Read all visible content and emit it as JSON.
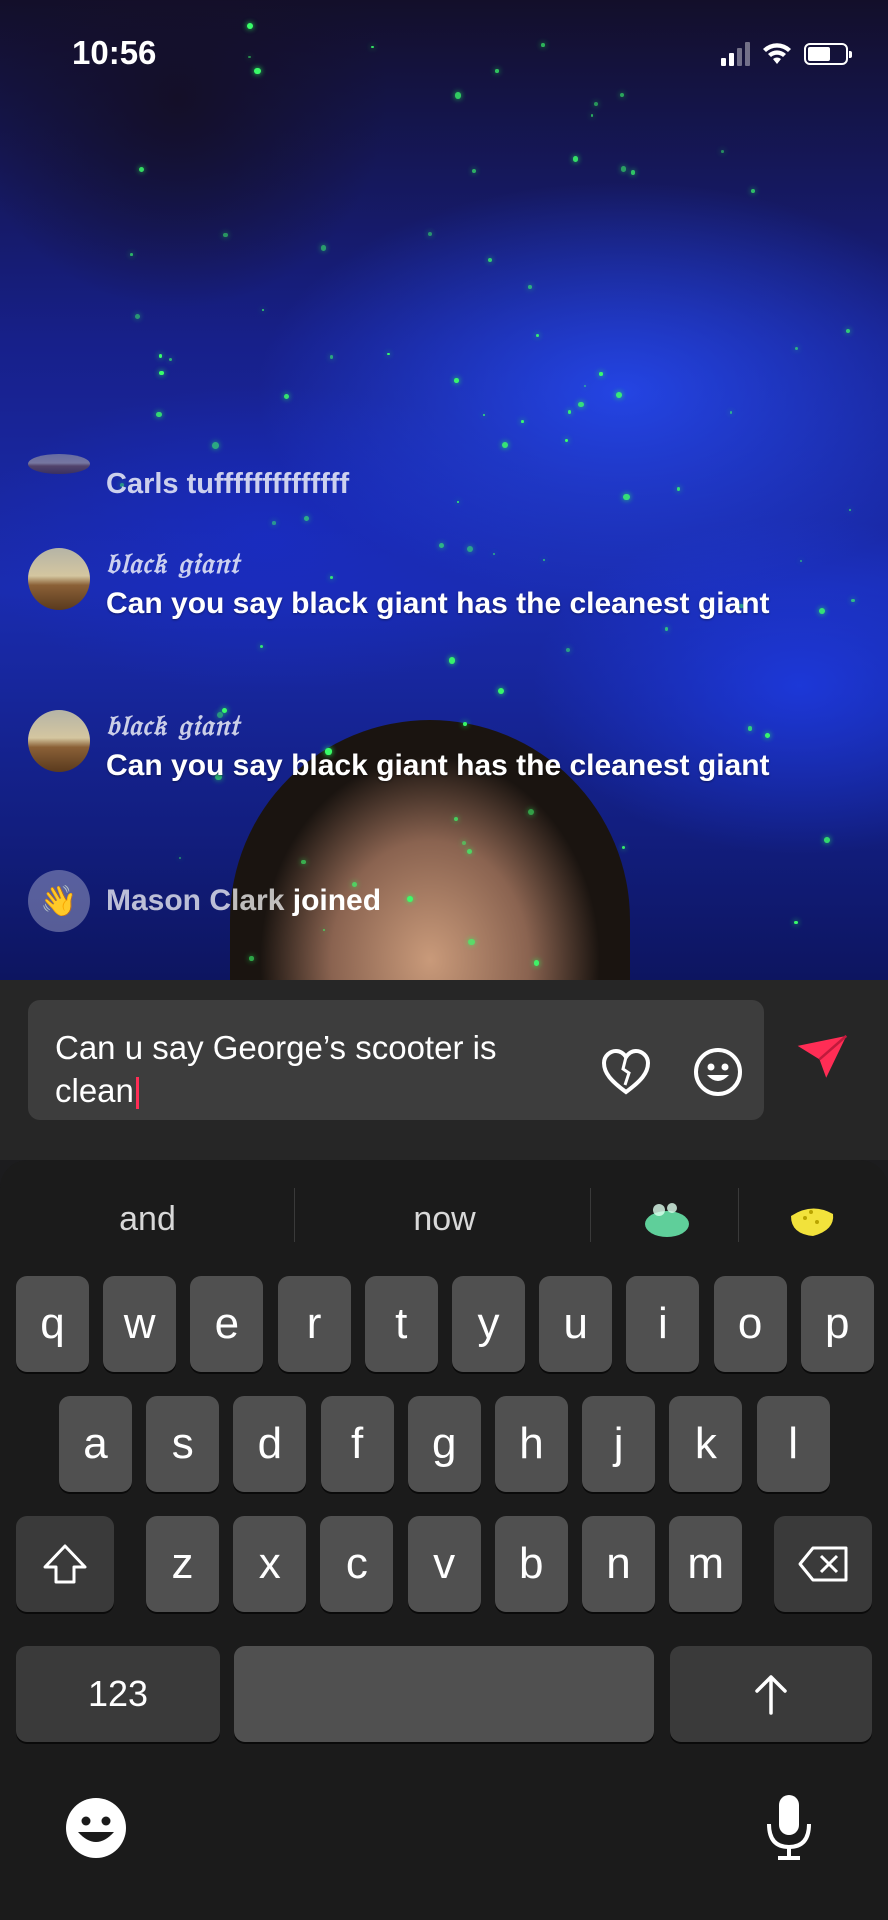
{
  "status_bar": {
    "time": "10:56"
  },
  "chat": {
    "messages": [
      {
        "user": "",
        "text": "Carls tuffffffffffffff",
        "type": "system"
      },
      {
        "user": "𝔟𝔩𝔞𝔠𝔨 𝔤𝔦𝔞𝔫𝔱",
        "text": "Can you say black giant has the cleanest giant",
        "type": "comment"
      },
      {
        "user": "𝔟𝔩𝔞𝔠𝔨 𝔤𝔦𝔞𝔫𝔱",
        "text": "Can you say black giant has the cleanest giant",
        "type": "comment"
      },
      {
        "user": "Mason Clark",
        "text": "joined",
        "type": "join"
      }
    ]
  },
  "input": {
    "value": "Can u say George’s scooter is clean"
  },
  "suggestions": [
    "and",
    "now"
  ],
  "keyboard": {
    "row1": [
      "q",
      "w",
      "e",
      "r",
      "t",
      "y",
      "u",
      "i",
      "o",
      "p"
    ],
    "row2": [
      "a",
      "s",
      "d",
      "f",
      "g",
      "h",
      "j",
      "k",
      "l"
    ],
    "row3": [
      "z",
      "x",
      "c",
      "v",
      "b",
      "n",
      "m"
    ],
    "numbers_key": "123"
  },
  "colors": {
    "accent": "#ff2d55",
    "keyboard_bg": "#1b1b1b",
    "key_bg": "#505050"
  }
}
